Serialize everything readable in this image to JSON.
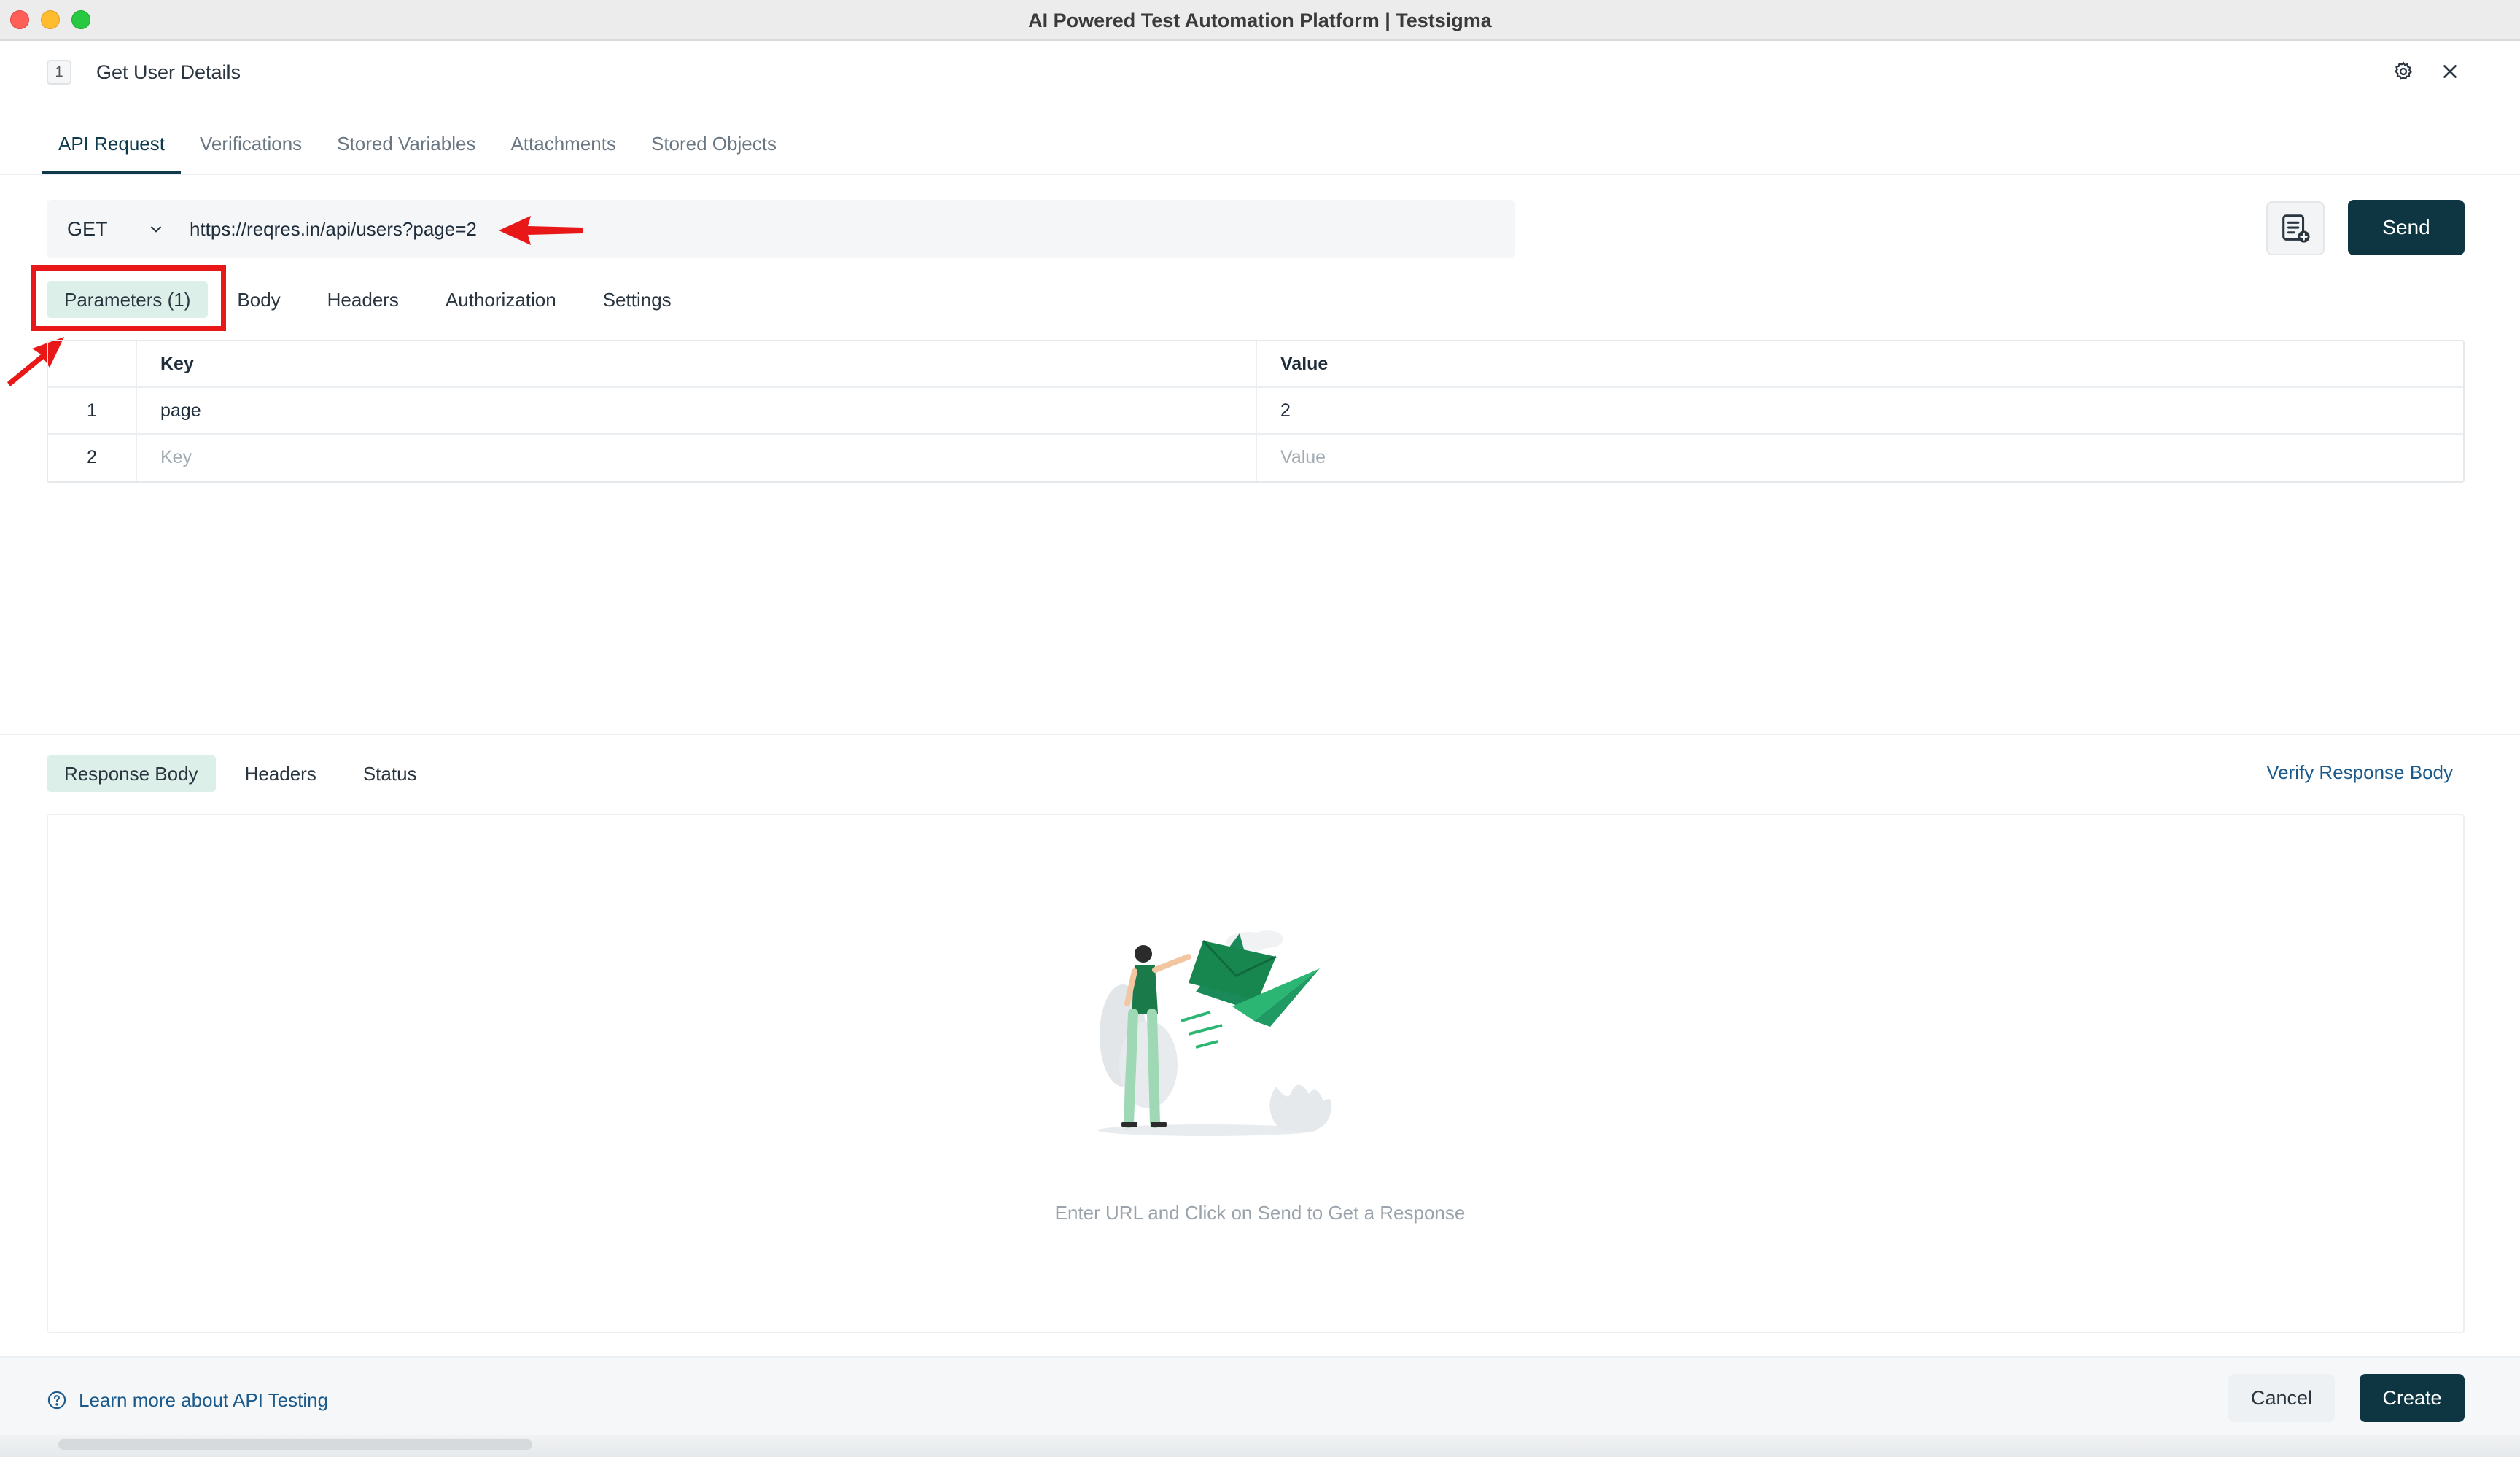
{
  "window": {
    "title": "AI Powered Test Automation Platform | Testsigma"
  },
  "header": {
    "step_number": "1",
    "step_title": "Get User Details"
  },
  "top_tabs": [
    {
      "label": "API Request",
      "active": true
    },
    {
      "label": "Verifications",
      "active": false
    },
    {
      "label": "Stored Variables",
      "active": false
    },
    {
      "label": "Attachments",
      "active": false
    },
    {
      "label": "Stored Objects",
      "active": false
    }
  ],
  "request": {
    "method": "GET",
    "url": "https://reqres.in/api/users?page=2",
    "send_label": "Send"
  },
  "request_tabs": [
    {
      "label": "Parameters (1)",
      "active": true
    },
    {
      "label": "Body",
      "active": false
    },
    {
      "label": "Headers",
      "active": false
    },
    {
      "label": "Authorization",
      "active": false
    },
    {
      "label": "Settings",
      "active": false
    }
  ],
  "params_table": {
    "headers": {
      "key": "Key",
      "value": "Value"
    },
    "rows": [
      {
        "num": "1",
        "key": "page",
        "value": "2",
        "placeholder": false
      },
      {
        "num": "2",
        "key": "Key",
        "value": "Value",
        "placeholder": true
      }
    ]
  },
  "response_tabs": [
    {
      "label": "Response Body",
      "active": true
    },
    {
      "label": "Headers",
      "active": false
    },
    {
      "label": "Status",
      "active": false
    }
  ],
  "response": {
    "verify_link": "Verify Response Body",
    "empty_message": "Enter URL and Click on Send to Get a Response"
  },
  "footer": {
    "learn_more": "Learn more about API Testing",
    "cancel_label": "Cancel",
    "create_label": "Create"
  },
  "colors": {
    "primary": "#0d3642",
    "active_tab_bg": "#dcefe8",
    "link": "#1b5a8a",
    "annotation_red": "#e81818"
  }
}
